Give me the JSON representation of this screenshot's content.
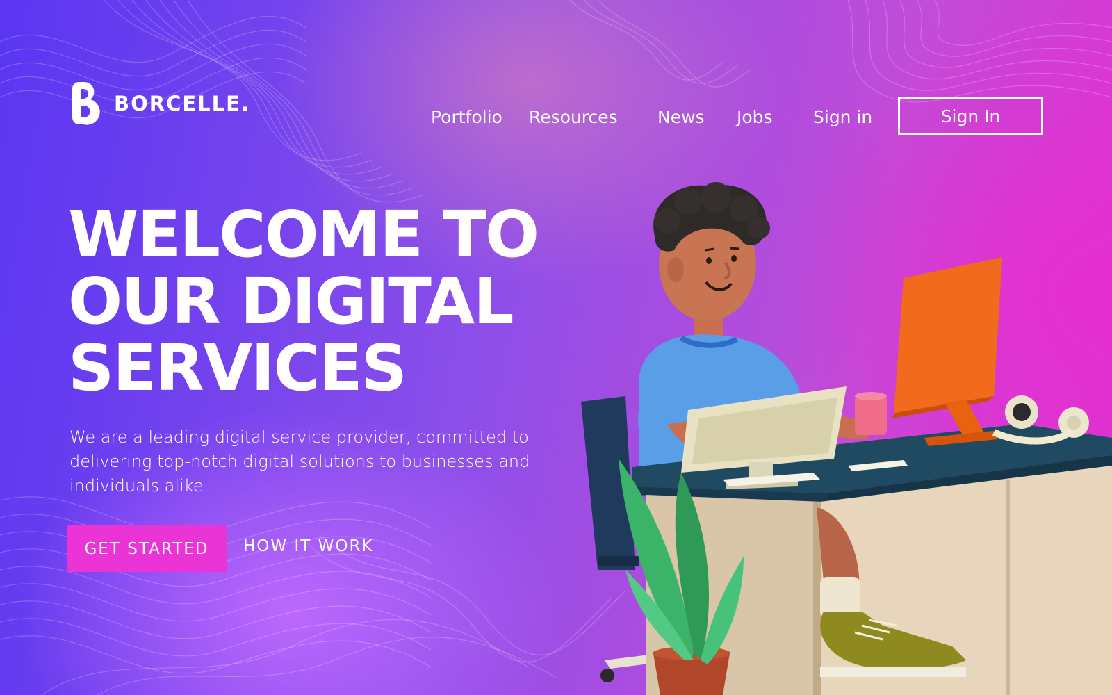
{
  "brand": {
    "name": "BORCELLE."
  },
  "nav": {
    "items": [
      "Portfolio",
      "Resources",
      "News",
      "Jobs",
      "Sign in"
    ],
    "cta": "Sign In"
  },
  "hero": {
    "title_lines": [
      "WELCOME TO",
      "OUR DIGITAL",
      "SERVICES"
    ],
    "description": "We are a leading digital service provider, committed to delivering top-notch digital solutions to businesses and individuals alike.",
    "primary_button": "GET STARTED",
    "secondary_link": "HOW IT WORK"
  },
  "colors": {
    "primary_button": "#ea34d6",
    "text": "#ffffff"
  },
  "icons": [
    "logo-b-icon"
  ]
}
